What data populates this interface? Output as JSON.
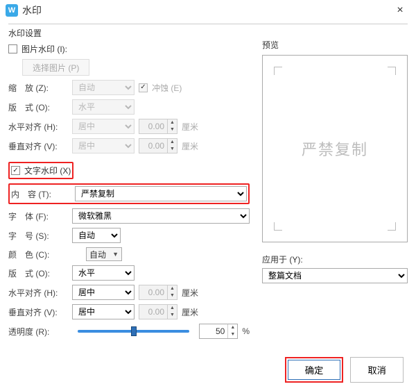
{
  "titlebar": {
    "title": "水印",
    "close": "×",
    "logo": "W"
  },
  "group": {
    "legend": "水印设置"
  },
  "image": {
    "checkbox_label": "图片水印 (I):",
    "select_btn": "选择图片 (P)",
    "zoom_label": "缩　放 (Z):",
    "zoom_value": "自动",
    "erode_label": "冲蚀 (E)",
    "layout_label": "版　式 (O):",
    "layout_value": "水平",
    "halign_label": "水平对齐 (H):",
    "halign_value": "居中",
    "halign_num": "0.00",
    "valign_label": "垂直对齐 (V):",
    "valign_value": "居中",
    "valign_num": "0.00",
    "unit": "厘米"
  },
  "text": {
    "checkbox_label": "文字水印 (X)",
    "content_label": "内　容 (T):",
    "content_value": "严禁复制",
    "font_label": "字　体 (F):",
    "font_value": "微软雅黑",
    "size_label": "字　号 (S):",
    "size_value": "自动",
    "color_label": "颜　色 (C):",
    "color_btn": "自动",
    "layout_label": "版　式 (O):",
    "layout_value": "水平",
    "halign_label": "水平对齐 (H):",
    "halign_value": "居中",
    "halign_num": "0.00",
    "valign_label": "垂直对齐 (V):",
    "valign_value": "居中",
    "valign_num": "0.00",
    "unit": "厘米",
    "opacity_label": "透明度 (R):",
    "opacity_value": "50",
    "opacity_unit": "%"
  },
  "preview": {
    "label": "预览",
    "text": "严禁复制"
  },
  "apply": {
    "label": "应用于 (Y):",
    "value": "整篇文档"
  },
  "footer": {
    "ok": "确定",
    "cancel": "取消"
  }
}
